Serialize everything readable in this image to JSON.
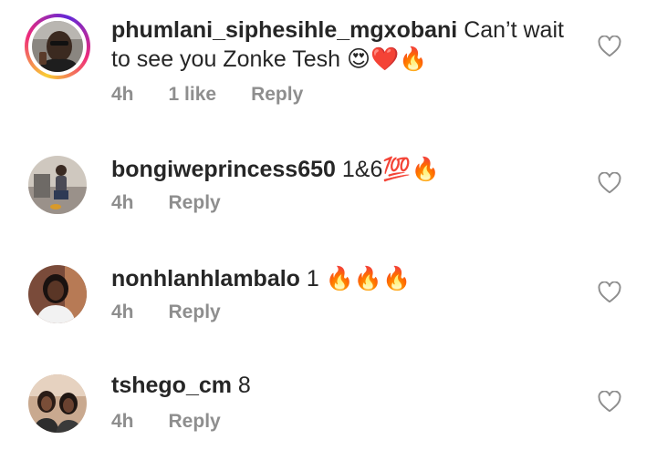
{
  "comments": [
    {
      "username": "phumlani_siphesihle_mgxobani",
      "text_line1": " Can’t wait",
      "text_line2": "to see you Zonke Tesh ",
      "emojis": "😍❤️🔥",
      "time": "4h",
      "likes": "1 like",
      "reply_label": "Reply",
      "has_story": true,
      "avatar_icon": "profile-photo-man"
    },
    {
      "username": "bongiweprincess650",
      "text": " 1&6",
      "emojis": "💯🔥",
      "time": "4h",
      "reply_label": "Reply",
      "has_story": false,
      "avatar_icon": "profile-photo-woman-seated"
    },
    {
      "username": "nonhlanhlambalo",
      "text": " 1 ",
      "emojis": "🔥🔥🔥",
      "time": "4h",
      "reply_label": "Reply",
      "has_story": false,
      "avatar_icon": "profile-photo-woman"
    },
    {
      "username": "tshego_cm",
      "text": " 8",
      "time": "4h",
      "reply_label": "Reply",
      "has_story": false,
      "avatar_icon": "profile-photo-two-people"
    }
  ],
  "colors": {
    "text": "#262626",
    "meta": "#8e8e8e",
    "heart_outline": "#8e8e8e"
  },
  "icons": {
    "like": "heart-outline-icon"
  }
}
